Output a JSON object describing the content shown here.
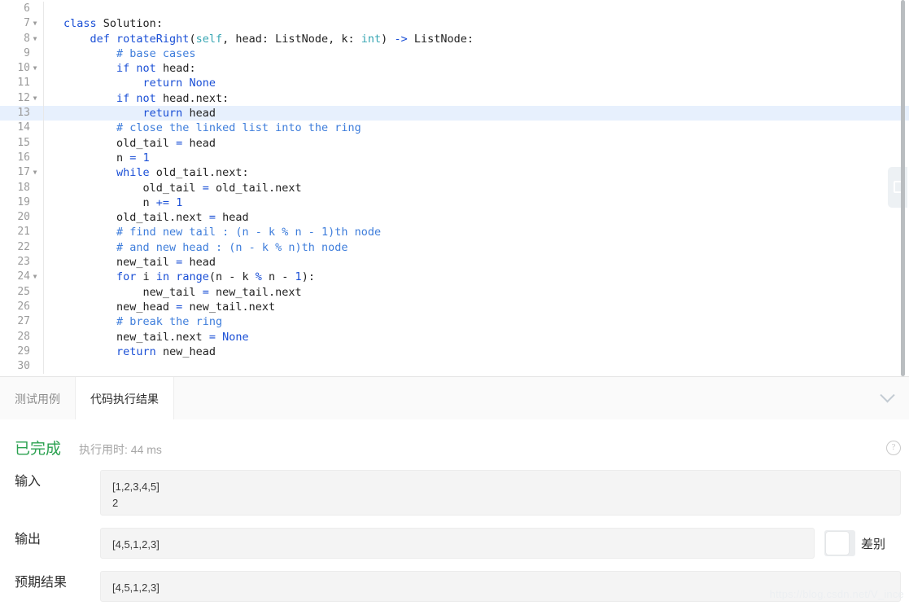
{
  "editor": {
    "first_line_number": 6,
    "active_line": 13,
    "language": "python",
    "widget_icon": "copy-icon",
    "scrollbar": true,
    "lines": [
      {
        "n": 6,
        "fold": false,
        "tokens": []
      },
      {
        "n": 7,
        "fold": true,
        "tokens": [
          {
            "t": "class ",
            "c": "kw"
          },
          {
            "t": "Solution",
            "c": "pl"
          },
          {
            "t": ":",
            "c": "pl"
          }
        ]
      },
      {
        "n": 8,
        "fold": true,
        "tokens": [
          {
            "t": "    ",
            "c": "pl"
          },
          {
            "t": "def ",
            "c": "kw"
          },
          {
            "t": "rotateRight",
            "c": "fn"
          },
          {
            "t": "(",
            "c": "pl"
          },
          {
            "t": "self",
            "c": "bi"
          },
          {
            "t": ", head: ListNode, k: ",
            "c": "pl"
          },
          {
            "t": "int",
            "c": "bi"
          },
          {
            "t": ") ",
            "c": "pl"
          },
          {
            "t": "->",
            "c": "op"
          },
          {
            "t": " ListNode:",
            "c": "pl"
          }
        ]
      },
      {
        "n": 9,
        "fold": false,
        "tokens": [
          {
            "t": "        ",
            "c": "pl"
          },
          {
            "t": "# base cases",
            "c": "cm"
          }
        ]
      },
      {
        "n": 10,
        "fold": true,
        "tokens": [
          {
            "t": "        ",
            "c": "pl"
          },
          {
            "t": "if not",
            "c": "kw"
          },
          {
            "t": " head:",
            "c": "pl"
          }
        ]
      },
      {
        "n": 11,
        "fold": false,
        "tokens": [
          {
            "t": "            ",
            "c": "pl"
          },
          {
            "t": "return ",
            "c": "kw"
          },
          {
            "t": "None",
            "c": "kw"
          }
        ]
      },
      {
        "n": 12,
        "fold": true,
        "tokens": [
          {
            "t": "        ",
            "c": "pl"
          },
          {
            "t": "if not",
            "c": "kw"
          },
          {
            "t": " head.next:",
            "c": "pl"
          }
        ]
      },
      {
        "n": 13,
        "fold": false,
        "tokens": [
          {
            "t": "            ",
            "c": "pl"
          },
          {
            "t": "return ",
            "c": "kw"
          },
          {
            "t": "head",
            "c": "pl"
          }
        ]
      },
      {
        "n": 14,
        "fold": false,
        "tokens": [
          {
            "t": "        ",
            "c": "pl"
          },
          {
            "t": "# close the linked list into the ring",
            "c": "cm"
          }
        ]
      },
      {
        "n": 15,
        "fold": false,
        "tokens": [
          {
            "t": "        old_tail ",
            "c": "pl"
          },
          {
            "t": "=",
            "c": "op"
          },
          {
            "t": " head",
            "c": "pl"
          }
        ]
      },
      {
        "n": 16,
        "fold": false,
        "tokens": [
          {
            "t": "        n ",
            "c": "pl"
          },
          {
            "t": "=",
            "c": "op"
          },
          {
            "t": " ",
            "c": "pl"
          },
          {
            "t": "1",
            "c": "num"
          }
        ]
      },
      {
        "n": 17,
        "fold": true,
        "tokens": [
          {
            "t": "        ",
            "c": "pl"
          },
          {
            "t": "while",
            "c": "kw"
          },
          {
            "t": " old_tail.next:",
            "c": "pl"
          }
        ]
      },
      {
        "n": 18,
        "fold": false,
        "tokens": [
          {
            "t": "            old_tail ",
            "c": "pl"
          },
          {
            "t": "=",
            "c": "op"
          },
          {
            "t": " old_tail.next",
            "c": "pl"
          }
        ]
      },
      {
        "n": 19,
        "fold": false,
        "tokens": [
          {
            "t": "            n ",
            "c": "pl"
          },
          {
            "t": "+=",
            "c": "op"
          },
          {
            "t": " ",
            "c": "pl"
          },
          {
            "t": "1",
            "c": "num"
          }
        ]
      },
      {
        "n": 20,
        "fold": false,
        "tokens": [
          {
            "t": "        old_tail.next ",
            "c": "pl"
          },
          {
            "t": "=",
            "c": "op"
          },
          {
            "t": " head",
            "c": "pl"
          }
        ]
      },
      {
        "n": 21,
        "fold": false,
        "tokens": [
          {
            "t": "        ",
            "c": "pl"
          },
          {
            "t": "# find new tail : (n - k % n - 1)th node",
            "c": "cm"
          }
        ]
      },
      {
        "n": 22,
        "fold": false,
        "tokens": [
          {
            "t": "        ",
            "c": "pl"
          },
          {
            "t": "# and new head : (n - k % n)th node",
            "c": "cm"
          }
        ]
      },
      {
        "n": 23,
        "fold": false,
        "tokens": [
          {
            "t": "        new_tail ",
            "c": "pl"
          },
          {
            "t": "=",
            "c": "op"
          },
          {
            "t": " head",
            "c": "pl"
          }
        ]
      },
      {
        "n": 24,
        "fold": true,
        "tokens": [
          {
            "t": "        ",
            "c": "pl"
          },
          {
            "t": "for",
            "c": "kw"
          },
          {
            "t": " i ",
            "c": "pl"
          },
          {
            "t": "in",
            "c": "kw"
          },
          {
            "t": " ",
            "c": "pl"
          },
          {
            "t": "range",
            "c": "fn"
          },
          {
            "t": "(n - k ",
            "c": "pl"
          },
          {
            "t": "%",
            "c": "op"
          },
          {
            "t": " n - ",
            "c": "pl"
          },
          {
            "t": "1",
            "c": "num"
          },
          {
            "t": "):",
            "c": "pl"
          }
        ]
      },
      {
        "n": 25,
        "fold": false,
        "tokens": [
          {
            "t": "            new_tail ",
            "c": "pl"
          },
          {
            "t": "=",
            "c": "op"
          },
          {
            "t": " new_tail.next",
            "c": "pl"
          }
        ]
      },
      {
        "n": 26,
        "fold": false,
        "tokens": [
          {
            "t": "        new_head ",
            "c": "pl"
          },
          {
            "t": "=",
            "c": "op"
          },
          {
            "t": " new_tail.next",
            "c": "pl"
          }
        ]
      },
      {
        "n": 27,
        "fold": false,
        "tokens": [
          {
            "t": "        ",
            "c": "pl"
          },
          {
            "t": "# break the ring",
            "c": "cm"
          }
        ]
      },
      {
        "n": 28,
        "fold": false,
        "tokens": [
          {
            "t": "        new_tail.next ",
            "c": "pl"
          },
          {
            "t": "=",
            "c": "op"
          },
          {
            "t": " ",
            "c": "pl"
          },
          {
            "t": "None",
            "c": "kw"
          }
        ]
      },
      {
        "n": 29,
        "fold": false,
        "tokens": [
          {
            "t": "        ",
            "c": "pl"
          },
          {
            "t": "return",
            "c": "kw"
          },
          {
            "t": " new_head",
            "c": "pl"
          }
        ]
      },
      {
        "n": 30,
        "fold": false,
        "tokens": []
      }
    ]
  },
  "tabs": [
    {
      "id": "testcase",
      "label": "测试用例",
      "active": false
    },
    {
      "id": "result",
      "label": "代码执行结果",
      "active": true
    }
  ],
  "collapse_icon": "chevron-down-icon",
  "result": {
    "status": "已完成",
    "status_color": "#2ba150",
    "runtime": "执行用时: 44 ms",
    "help_icon": "question-circle-icon",
    "rows": [
      {
        "id": "input",
        "label": "输入",
        "value": "[1,2,3,4,5]\n2"
      },
      {
        "id": "output",
        "label": "输出",
        "value": "[4,5,1,2,3]"
      },
      {
        "id": "expected",
        "label": "预期结果",
        "value": "[4,5,1,2,3]"
      }
    ],
    "diff": {
      "label": "差别",
      "on": false
    }
  },
  "watermark": "https://blog.csdn.net/V_ince"
}
